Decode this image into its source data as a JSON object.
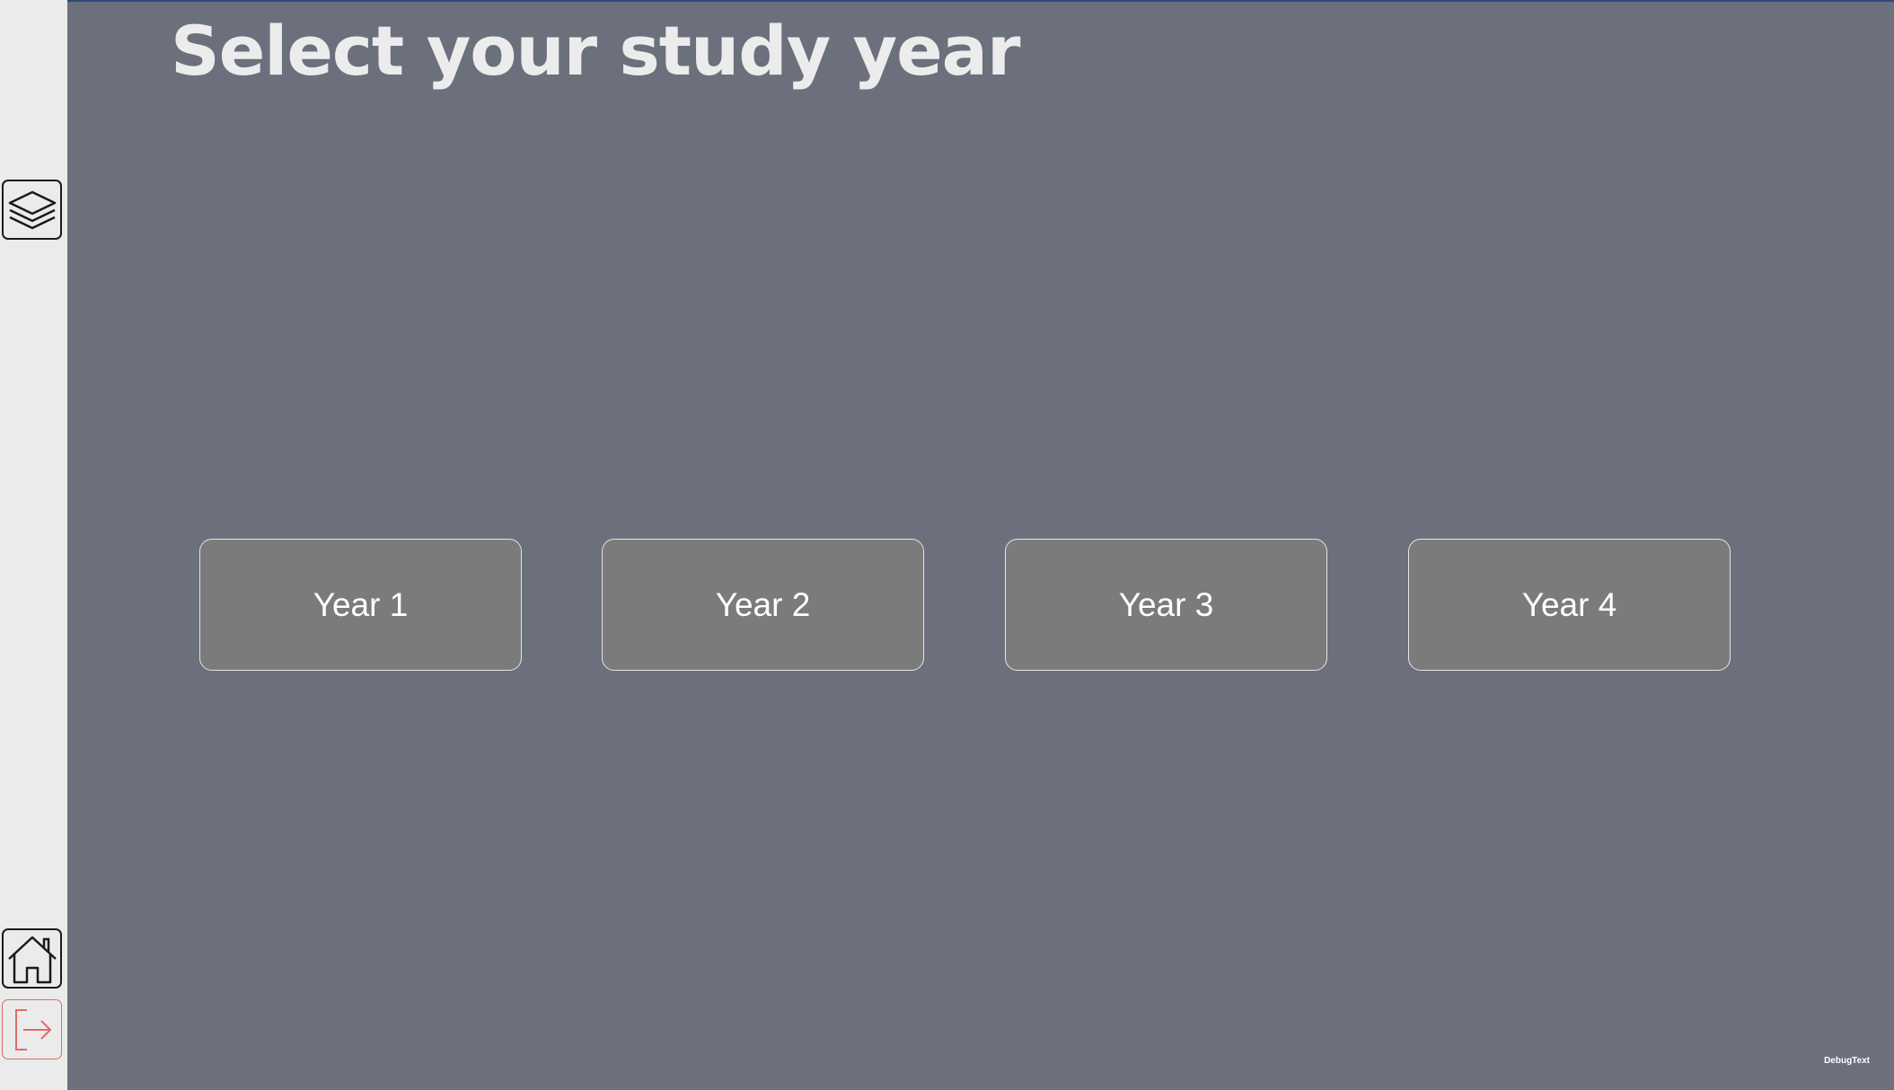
{
  "page": {
    "title": "Select your study year",
    "debug_text": "DebugText"
  },
  "sidebar": {
    "top_button": {
      "icon": "layers-icon"
    },
    "bottom_buttons": [
      {
        "icon": "home-icon"
      },
      {
        "icon": "logout-icon",
        "color": "#e06a6a"
      }
    ]
  },
  "years": [
    {
      "label": "Year 1"
    },
    {
      "label": "Year 2"
    },
    {
      "label": "Year 3"
    },
    {
      "label": "Year 4"
    }
  ],
  "colors": {
    "background": "#6b707c",
    "sidebar": "#ebebeb",
    "button_fill": "#7b7b7b",
    "button_border": "#e4e4e4",
    "title_text": "#ececec",
    "logout_accent": "#e06a6a"
  }
}
